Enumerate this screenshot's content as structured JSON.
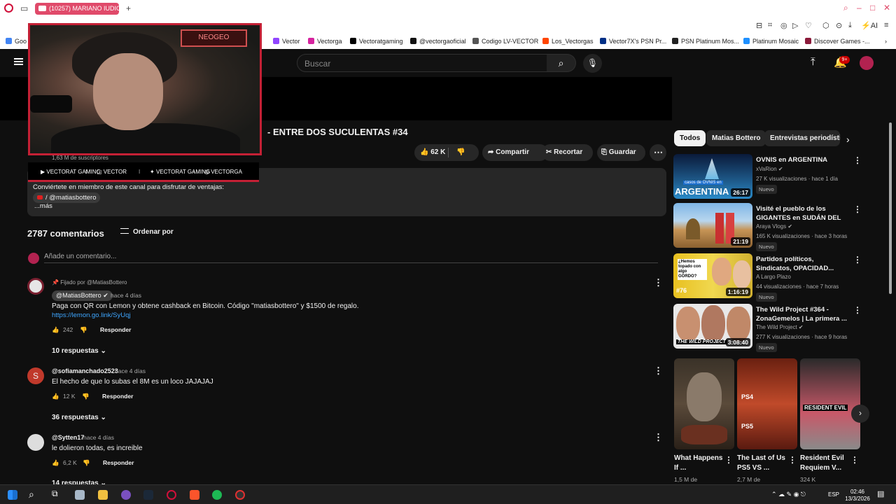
{
  "browser": {
    "tab_title": "(10257) MARIANO IUDICA",
    "bookmarks": [
      "Goo",
      "r",
      "Vector",
      "Vectorga",
      "Vectoratgaming",
      "@vectorgaoficial",
      "Codigo LV-VECTOR",
      "Los_Vectorgas",
      "Vector7X's PSN Pr...",
      "PSN Platinum Mos...",
      "Platinum Mosaic",
      "Discover Games -..."
    ],
    "ai_label": "AI"
  },
  "header": {
    "search_placeholder": "Buscar",
    "notif_count": "9+"
  },
  "overlay": {
    "neo_label": "NEOGEO",
    "socials": [
      "VECTORAT GAMING",
      "VECTOR",
      "VECTORAT GAMING",
      "VECTORGA"
    ]
  },
  "video": {
    "title": "- ENTRE DOS SUCULENTAS #34",
    "subscribers": "1,63 M de suscriptores",
    "likes": "62 K",
    "share": "Compartir",
    "clip": "Recortar",
    "save": "Guardar"
  },
  "description": {
    "line1": "Conviértete en miembro de este canal para disfrutar de ventajas:",
    "chip": "/ @matiasbottero",
    "more": "...más"
  },
  "comments_header": {
    "count": "2787 comentarios",
    "sort": "Ordenar por",
    "add_placeholder": "Añade un comentario..."
  },
  "comments": [
    {
      "pinned": "Fijado por @MatiasBottero",
      "author": "@MatiasBottero",
      "when": "hace 4 días",
      "text": "Paga con QR con Lemon y obtene cashback en Bitcoin. Código \"matiasbottero\" y $1500 de regalo.",
      "link": "https://lemon.go.link/SyUqj",
      "likes": "242",
      "reply": "Responder",
      "replies": "10 respuestas"
    },
    {
      "author": "@sofiamanchado2523",
      "when": "hace 4 días",
      "text": "El hecho de que lo subas el 8M es un loco JAJAJAJ",
      "likes": "12 K",
      "reply": "Responder",
      "replies": "36 respuestas",
      "initial": "S"
    },
    {
      "author": "@Sytten17",
      "when": "hace 4 días",
      "text": "le dolieron todas, es increible",
      "likes": "6,2 K",
      "reply": "Responder",
      "replies": "14 respuestas"
    }
  ],
  "sidebar": {
    "chips": [
      "Todos",
      "Matias Bottero",
      "Entrevistas periodístic"
    ],
    "videos": [
      {
        "title": "OVNIS en ARGENTINA",
        "channel": "xVaRion",
        "meta": "27 K visualizaciones · hace 1 día",
        "duration": "26:17",
        "badge": "Nuevo",
        "thumb_text": "ARGENTINA",
        "thumb_small": "casos de OVNIS en"
      },
      {
        "title": "Visité el pueblo de los GIGANTES en SUDÁN DEL SU...",
        "channel": "Araya Vlogs",
        "meta": "165 K visualizaciones · hace 3 horas",
        "duration": "21:19",
        "badge": "Nuevo"
      },
      {
        "title": "Partidos políticos, Sindicatos, OPACIDAD... ¿Estamos ante u...",
        "channel": "A Largo Plazo",
        "meta": "44 visualizaciones · hace 7 horas",
        "duration": "1:16:19",
        "badge": "Nuevo",
        "thumb_text": "¿Hemos topado con algo GORDO?",
        "thumb_num": "#76"
      },
      {
        "title": "The Wild Project #364 - ZonaGemelos | La primera ...",
        "channel": "The Wild Project",
        "meta": "277 K visualizaciones · hace 9 horas",
        "duration": "3:08:40",
        "badge": "Nuevo",
        "thumb_text": "THE WILD PROJECT"
      }
    ],
    "shorts": [
      {
        "title": "What Happens If ...",
        "meta": "1,5 M de"
      },
      {
        "title": "The Last of Us PS5 VS ...",
        "meta": "2,7 M de",
        "labels": [
          "PS4",
          "PS5"
        ]
      },
      {
        "title": "Resident Evil Requiem V...",
        "meta": "324 K",
        "thumb_text": "RESIDENT EVIL"
      }
    ]
  },
  "taskbar": {
    "lang": "ESP",
    "time": "02:46",
    "date": "13/3/2026"
  }
}
